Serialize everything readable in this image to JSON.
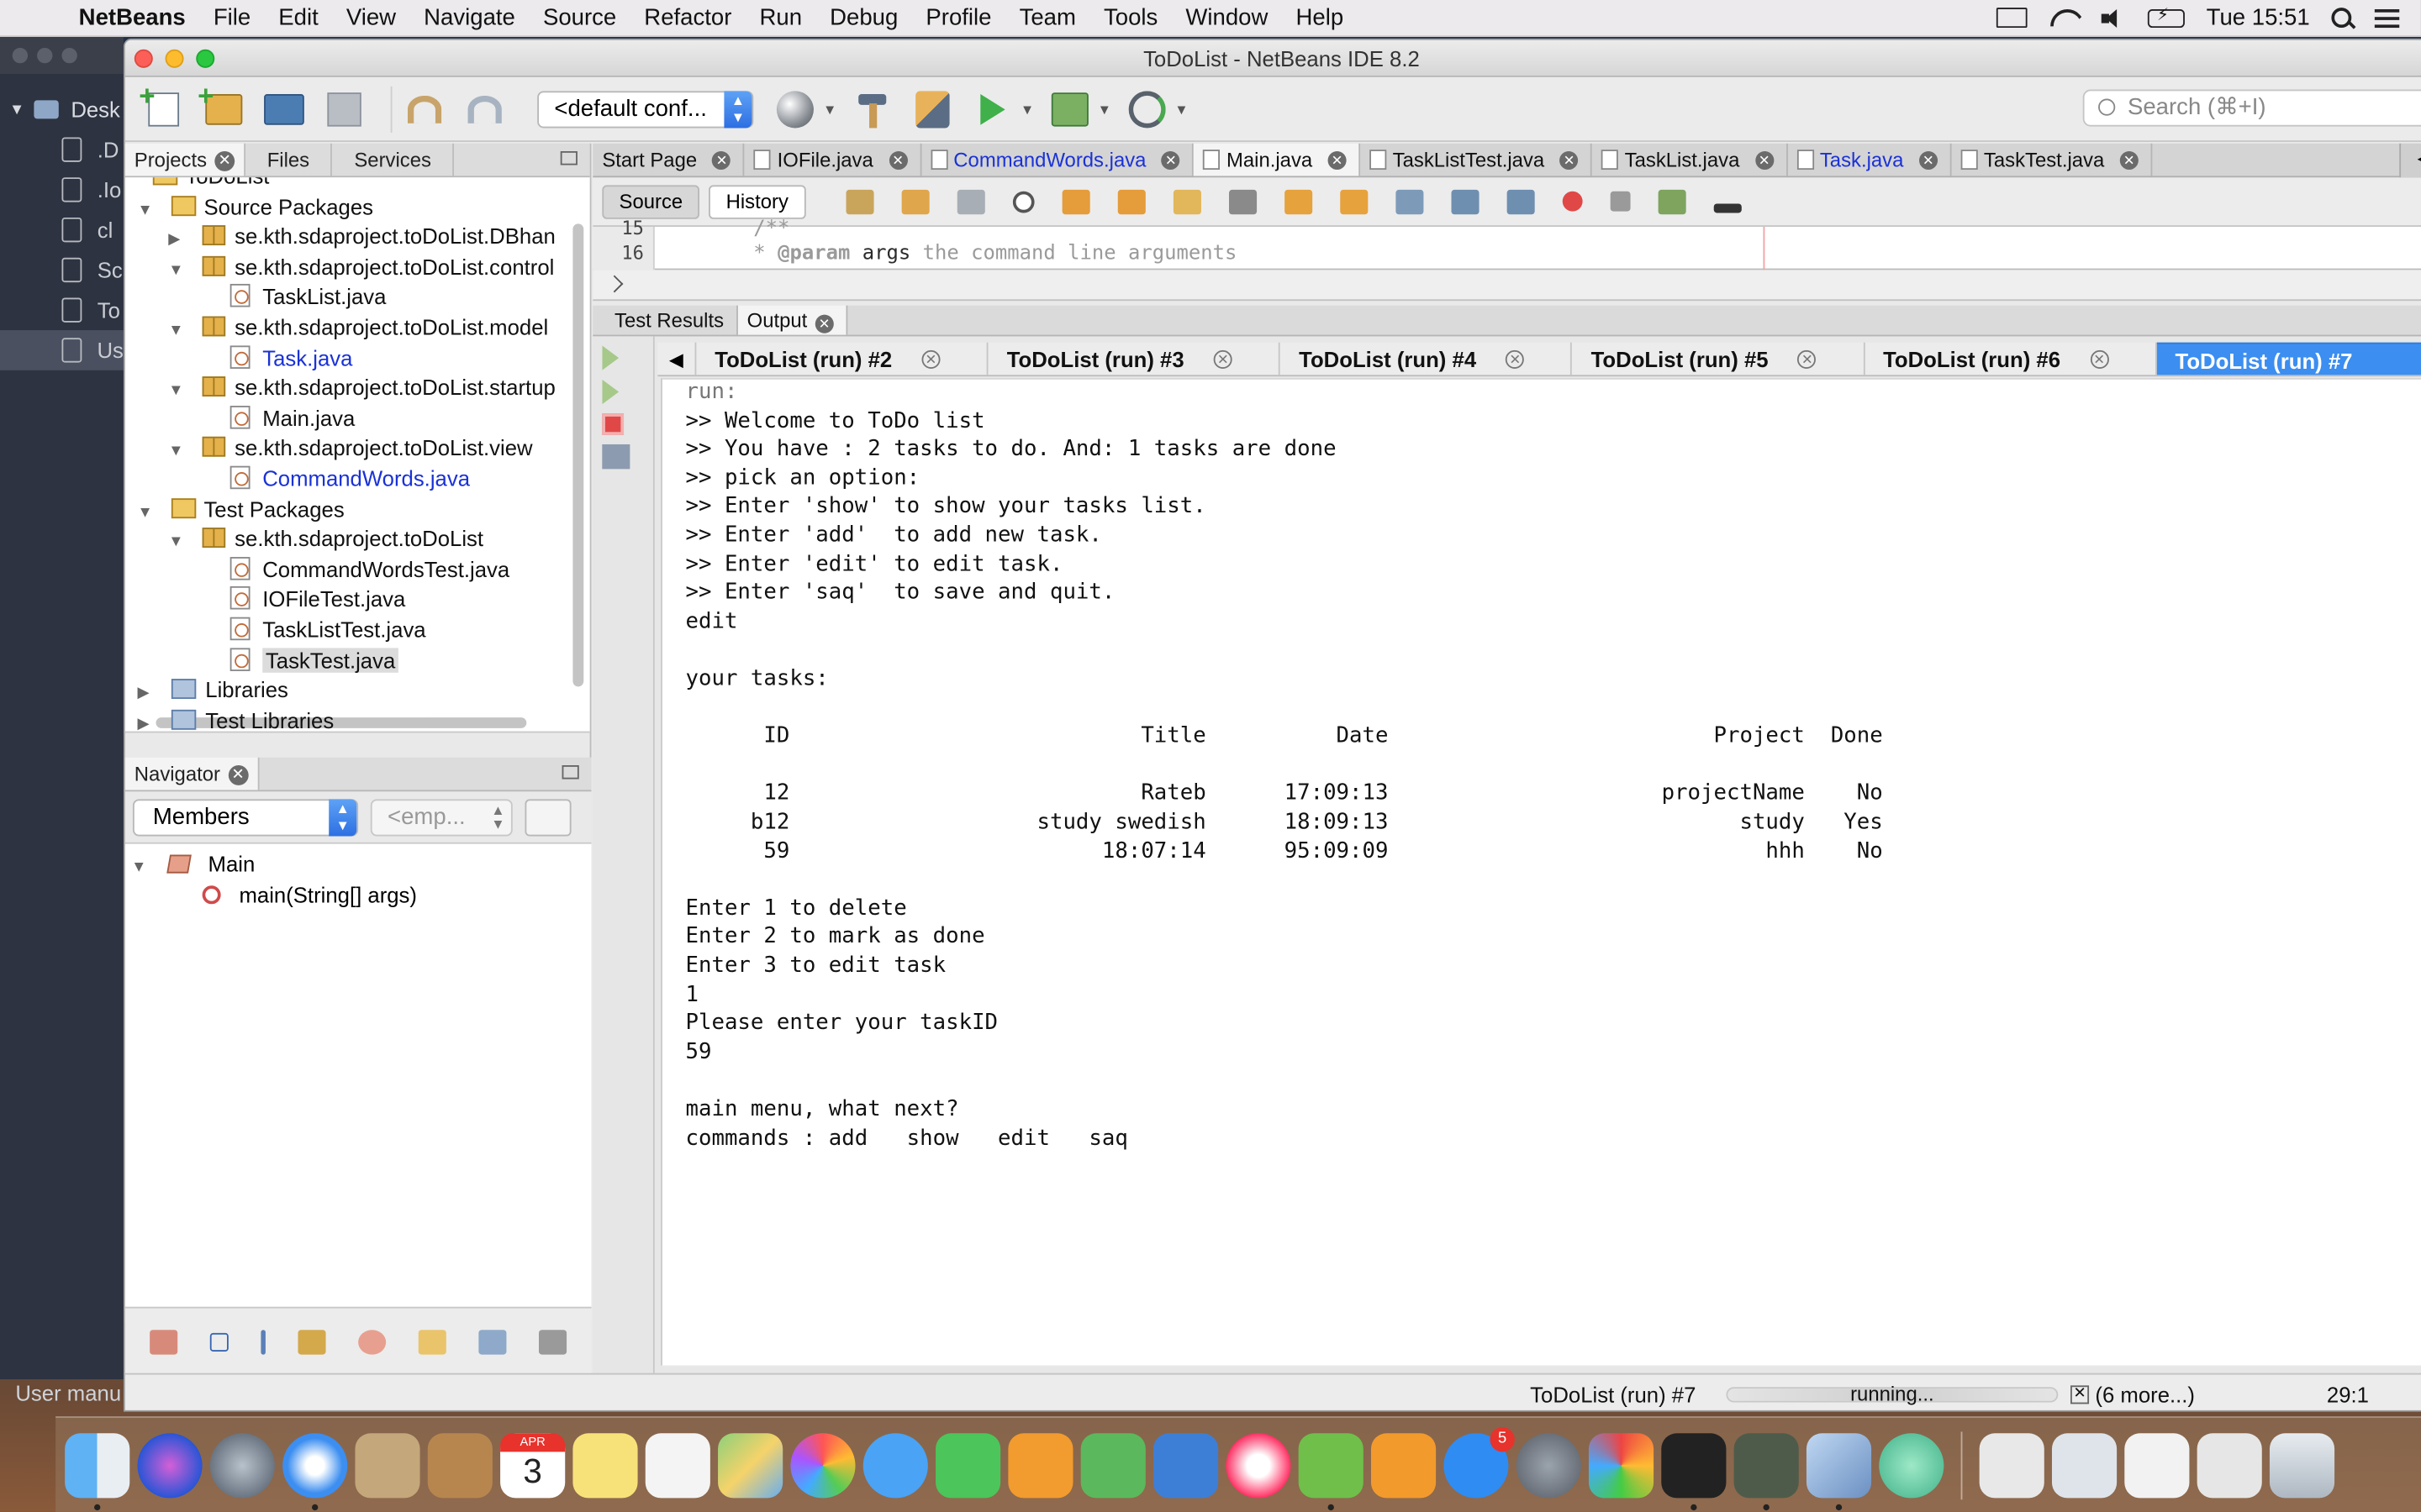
{
  "menubar": {
    "app_name": "NetBeans",
    "items": [
      "File",
      "Edit",
      "View",
      "Navigate",
      "Source",
      "Refactor",
      "Run",
      "Debug",
      "Profile",
      "Team",
      "Tools",
      "Window",
      "Help"
    ],
    "clock": "Tue 15:51"
  },
  "finder": {
    "header": "Desk",
    "rows": [
      ".D",
      ".Io",
      "cl",
      "Sc",
      "To",
      "Us"
    ],
    "user_manual": "User manu"
  },
  "window": {
    "title": "ToDoList - NetBeans IDE 8.2"
  },
  "toolbar": {
    "config_value": "<default conf...",
    "search_placeholder": "Search (⌘+I)"
  },
  "projects_panel": {
    "tabs": [
      "Projects",
      "Files",
      "Services"
    ],
    "tree": [
      {
        "label": "ToDoList",
        "indent": 0,
        "icon": "project",
        "twisty": ""
      },
      {
        "label": "Source Packages",
        "indent": 1,
        "icon": "srcpkg",
        "twisty": "▼"
      },
      {
        "label": "se.kth.sdaproject.toDoList.DBhan",
        "indent": 2,
        "icon": "pkg",
        "twisty": "▶"
      },
      {
        "label": "se.kth.sdaproject.toDoList.control",
        "indent": 2,
        "icon": "pkg",
        "twisty": "▼"
      },
      {
        "label": "TaskList.java",
        "indent": 3,
        "icon": "java",
        "twisty": ""
      },
      {
        "label": "se.kth.sdaproject.toDoList.model",
        "indent": 2,
        "icon": "pkg",
        "twisty": "▼"
      },
      {
        "label": "Task.java",
        "indent": 3,
        "icon": "java",
        "twisty": "",
        "blue": true
      },
      {
        "label": "se.kth.sdaproject.toDoList.startup",
        "indent": 2,
        "icon": "pkg",
        "twisty": "▼"
      },
      {
        "label": "Main.java",
        "indent": 3,
        "icon": "java",
        "twisty": ""
      },
      {
        "label": "se.kth.sdaproject.toDoList.view",
        "indent": 2,
        "icon": "pkg",
        "twisty": "▼"
      },
      {
        "label": "CommandWords.java",
        "indent": 3,
        "icon": "java",
        "twisty": "",
        "blue": true
      },
      {
        "label": "Test Packages",
        "indent": 1,
        "icon": "srcpkg",
        "twisty": "▼"
      },
      {
        "label": "se.kth.sdaproject.toDoList",
        "indent": 2,
        "icon": "pkg",
        "twisty": "▼"
      },
      {
        "label": "CommandWordsTest.java",
        "indent": 3,
        "icon": "java",
        "twisty": ""
      },
      {
        "label": "IOFileTest.java",
        "indent": 3,
        "icon": "java",
        "twisty": ""
      },
      {
        "label": "TaskListTest.java",
        "indent": 3,
        "icon": "java",
        "twisty": ""
      },
      {
        "label": "TaskTest.java",
        "indent": 3,
        "icon": "java",
        "twisty": "",
        "selected": true
      },
      {
        "label": "Libraries",
        "indent": 1,
        "icon": "lib",
        "twisty": "▶"
      },
      {
        "label": "Test Libraries",
        "indent": 1,
        "icon": "lib",
        "twisty": "▶"
      }
    ]
  },
  "navigator": {
    "title": "Navigator",
    "members_value": "Members",
    "filter_placeholder": "<emp...",
    "class_name": "Main",
    "method_name": "main(String[] args)"
  },
  "editor": {
    "tabs": [
      {
        "label": "Start Page",
        "blue": false,
        "active": false
      },
      {
        "label": "IOFile.java",
        "blue": false,
        "active": false
      },
      {
        "label": "CommandWords.java",
        "blue": true,
        "active": false
      },
      {
        "label": "Main.java",
        "blue": false,
        "active": true
      },
      {
        "label": "TaskListTest.java",
        "blue": false,
        "active": false
      },
      {
        "label": "TaskList.java",
        "blue": false,
        "active": false
      },
      {
        "label": "Task.java",
        "blue": true,
        "active": false
      },
      {
        "label": "TaskTest.java",
        "blue": false,
        "active": false
      }
    ],
    "source_label": "Source",
    "history_label": "History",
    "line_15": "15",
    "line_16": "16",
    "code_15": "/**",
    "code_16_star": "* ",
    "code_16_tag": "@param",
    "code_16_param": " args",
    "code_16_rest": " the command line arguments"
  },
  "output": {
    "tabs": [
      "Test Results",
      "Output"
    ],
    "run_tabs": [
      "ToDoList (run) #2",
      "ToDoList (run) #3",
      "ToDoList (run) #4",
      "ToDoList (run) #5",
      "ToDoList (run) #6",
      "ToDoList (run) #7"
    ],
    "lines": [
      "run:",
      ">> Welcome to ToDo list",
      ">> You have : 2 tasks to do. And: 1 tasks are done",
      ">> pick an option:",
      ">> Enter 'show' to show your tasks list.",
      ">> Enter 'add'  to add new task.",
      ">> Enter 'edit' to edit task.",
      ">> Enter 'saq'  to save and quit.",
      "edit",
      "",
      "your tasks:",
      "",
      "      ID                           Title          Date                         Project  Done",
      "",
      "      12                           Rateb      17:09:13                     projectName    No",
      "     b12                   study swedish      18:09:13                           study   Yes",
      "      59                        18:07:14      95:09:09                             hhh    No",
      "",
      "Enter 1 to delete",
      "Enter 2 to mark as done",
      "Enter 3 to edit task",
      "1",
      "Please enter your taskID",
      "59",
      "",
      "main menu, what next?",
      "commands : add   show   edit   saq"
    ]
  },
  "statusbar": {
    "run_label": "ToDoList (run) #7",
    "progress_text": "running...",
    "more_label": "(6 more...)",
    "position": "29:1"
  },
  "dock": {
    "calendar_month": "APR",
    "calendar_day": "3",
    "appstore_badge": "5"
  },
  "colors": {
    "active_run_tab": "#3c8ef0",
    "link_blue": "#1a32d6"
  }
}
